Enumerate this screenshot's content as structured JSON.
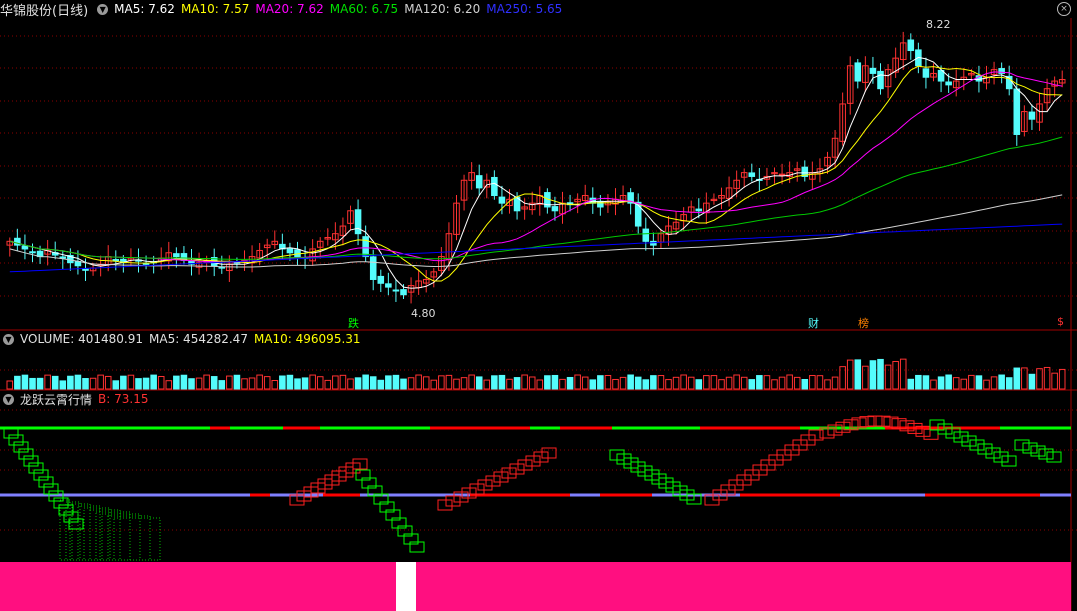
{
  "colors": {
    "up": "#ff3232",
    "down": "#54fcfc",
    "ma5": "#ffffff",
    "ma10": "#ffff00",
    "ma20": "#ff00ff",
    "ma60": "#00c800",
    "ma120": "#d0d0d0",
    "ma250": "#0000ff",
    "grid": "#8b0000",
    "pink": "#ff0f80"
  },
  "price_header": {
    "title": "华锦股份(日线)",
    "ma5": "MA5: 7.62",
    "ma10": "MA10: 7.57",
    "ma20": "MA20: 7.62",
    "ma60": "MA60: 6.75",
    "ma120": "MA120: 6.20",
    "ma250": "MA250: 5.65"
  },
  "price_panel": {
    "high_label": "8.22",
    "low_label": "4.80",
    "markers": [
      "跌",
      "财",
      "榜",
      "$"
    ]
  },
  "volume_header": {
    "vol": "VOLUME: 401480.91",
    "ma5": "MA5: 454282.47",
    "ma10": "MA10: 496095.31"
  },
  "indicator_header": {
    "name": "龙跃云霄行情",
    "value": "B: 73.15"
  },
  "chart_data": {
    "type": "candlestick",
    "y_price_range": [
      4.6,
      8.4
    ],
    "price_high": 8.22,
    "price_low": 4.8,
    "closes": [
      5.5,
      5.45,
      5.4,
      5.35,
      5.3,
      5.38,
      5.32,
      5.28,
      5.22,
      5.18,
      5.12,
      5.15,
      5.2,
      5.3,
      5.25,
      5.22,
      5.28,
      5.24,
      5.2,
      5.22,
      5.28,
      5.35,
      5.3,
      5.25,
      5.2,
      5.22,
      5.25,
      5.18,
      5.15,
      5.2,
      5.22,
      5.25,
      5.3,
      5.38,
      5.45,
      5.5,
      5.4,
      5.35,
      5.3,
      5.28,
      5.4,
      5.5,
      5.55,
      5.6,
      5.7,
      5.9,
      5.6,
      5.3,
      5.0,
      4.95,
      4.9,
      4.85,
      4.8,
      4.92,
      4.98,
      5.0,
      5.1,
      5.3,
      5.6,
      6.0,
      6.3,
      6.4,
      6.2,
      6.3,
      6.1,
      6.0,
      6.05,
      5.9,
      5.95,
      6.0,
      6.1,
      5.95,
      5.9,
      6.0,
      5.98,
      6.05,
      6.1,
      6.0,
      5.95,
      6.02,
      6.05,
      6.1,
      6.0,
      5.7,
      5.5,
      5.45,
      5.6,
      5.7,
      5.75,
      5.85,
      5.95,
      5.9,
      6.0,
      6.05,
      6.1,
      6.2,
      6.3,
      6.4,
      6.35,
      6.3,
      6.35,
      6.4,
      6.38,
      6.4,
      6.45,
      6.35,
      6.4,
      6.45,
      6.6,
      6.85,
      7.3,
      7.8,
      7.6,
      7.8,
      7.7,
      7.5,
      7.75,
      7.9,
      8.1,
      8.0,
      7.8,
      7.65,
      7.7,
      7.6,
      7.55,
      7.6,
      7.65,
      7.7,
      7.6,
      7.65,
      7.75,
      7.7,
      7.5,
      6.9,
      7.2,
      7.1,
      7.3,
      7.5,
      7.6,
      7.62
    ]
  }
}
